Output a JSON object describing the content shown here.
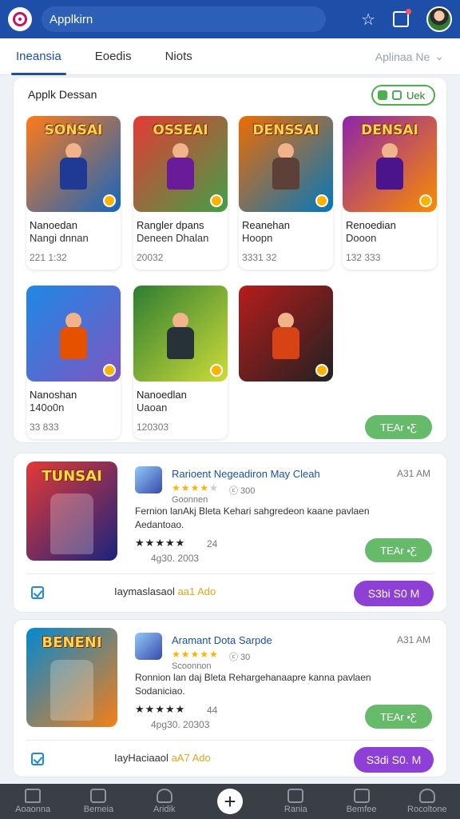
{
  "appbar": {
    "search_text": "Applkirn",
    "logo_icon": "app-logo-icon",
    "star_icon": "star-icon",
    "notify_icon": "notification-icon",
    "avatar_icon": "avatar"
  },
  "tabs": {
    "items": [
      "Ineansia",
      "Eoedis",
      "Niots"
    ],
    "active_index": 0,
    "dropdown_label": "Aplinaa Ne"
  },
  "grid": {
    "title": "Applk Dessan",
    "view_label": "Uek",
    "games": [
      {
        "name": "Nanoedan",
        "sub": "Nangi dnnan",
        "meta": "221 1:32",
        "logo": "SONSAI",
        "colors": [
          "#ff7a18",
          "#1565c0"
        ],
        "hero": "#1f3a93"
      },
      {
        "name": "Rangler dpans",
        "sub": "Deneen Dhalan",
        "meta": "20032",
        "logo": "OSSEAI",
        "colors": [
          "#e53935",
          "#43a047"
        ],
        "hero": "#6a1b9a"
      },
      {
        "name": "Reanehan",
        "sub": "Hoopn",
        "meta": "3331 32",
        "logo": "DENSSAI",
        "colors": [
          "#ef6c00",
          "#0277bd"
        ],
        "hero": "#5d4037"
      },
      {
        "name": "Renoedian",
        "sub": "Dooon",
        "meta": "132 333",
        "logo": "DENSAI",
        "colors": [
          "#8e24aa",
          "#fb8c00"
        ],
        "hero": "#4a148c"
      },
      {
        "name": "Nanoshan",
        "sub": "140o0n",
        "meta": "33 833",
        "logo": "",
        "colors": [
          "#1e88e5",
          "#7e57c2"
        ],
        "hero": "#e65100"
      },
      {
        "name": "Nanoedlan",
        "sub": "Uaoan",
        "meta": "120303",
        "logo": "",
        "colors": [
          "#2e7d32",
          "#cddc39"
        ],
        "hero": "#263238"
      },
      {
        "name": "",
        "sub": "",
        "meta": "",
        "logo": "",
        "colors": [
          "#b71c1c",
          "#212121"
        ],
        "hero": "#d84315"
      }
    ],
    "get_button": "TEAr •Ƹ"
  },
  "features": [
    {
      "logo": "TUNSAI",
      "colors": [
        "#e53935",
        "#1a237e"
      ],
      "title": "Rarioent Negeadiron May Cleah",
      "time": "A31 AM",
      "stars": [
        1,
        1,
        1,
        1,
        0
      ],
      "count": "ⓒ 300",
      "badge": "Goonnen",
      "desc": "Fernion lanAkj Bleta Kehari sahgredeon kaane pavlaen Aedantoao.",
      "rating_stars": [
        1,
        1,
        1,
        1,
        0
      ],
      "rating": "24",
      "date": "4g30. 2003",
      "get_button": "TEAr •Ƹ",
      "row_label": "Iaymaslasaol",
      "row_accent": "aa1 Ado",
      "buy_button": "S3bi S0 M"
    },
    {
      "logo": "BENENI",
      "colors": [
        "#0288d1",
        "#f57f17"
      ],
      "title": "Aramant Dota Sarpde",
      "time": "A31 AM",
      "stars": [
        1,
        1,
        1,
        1,
        1
      ],
      "count": "ⓒ 30",
      "badge": "Scoonnon",
      "desc": "Ronnion lan daj Bleta Rehargehanaapre kanna pavlaen Sodaniciao.",
      "rating_stars": [
        1,
        1,
        0,
        0,
        0
      ],
      "rating": "44",
      "date": "4pg30. 20303",
      "get_button": "TEAr •Ƹ",
      "row_label": "IayHaciaaol",
      "row_accent": "aA7 Ado",
      "buy_button": "S3di S0. M"
    }
  ],
  "bottom_nav": {
    "items": [
      "Aoaonna",
      "Bemeia",
      "Aridik",
      "",
      "Rania",
      "Bemfee",
      "Rocoltone"
    ]
  }
}
